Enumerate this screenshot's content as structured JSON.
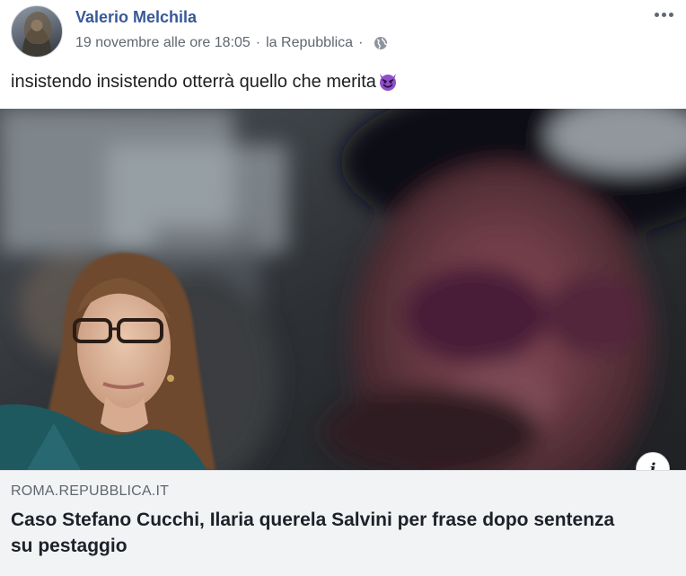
{
  "post": {
    "author": "Valerio Melchila",
    "date": "19 novembre alle ore 18:05",
    "separator": "·",
    "source": "la Repubblica",
    "separator2": "·",
    "privacy_icon": "globe-icon",
    "more_icon": "more-options-icon",
    "text": "insistendo insistendo otterrà quello che merita",
    "emoji": "smiling-devil-emoji"
  },
  "link": {
    "domain": "ROMA.REPUBBLICA.IT",
    "title": "Caso Stefano Cucchi, Ilaria querela Salvini per frase dopo sentenza su pestaggio",
    "info_label": "i"
  },
  "colors": {
    "author": "#385898",
    "meta": "#616770",
    "caption_bg": "#f2f3f5",
    "devil": "#7b3fb2"
  }
}
